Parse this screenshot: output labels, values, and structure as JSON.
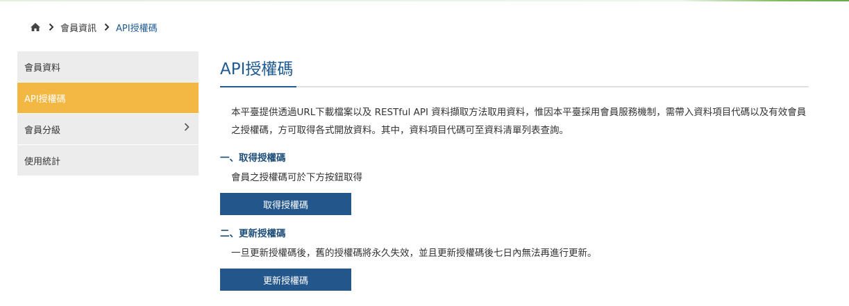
{
  "breadcrumb": {
    "home_icon": "home-icon",
    "separator_icon": "chevron-right-icon",
    "items": [
      "會員資訊",
      "API授權碼"
    ]
  },
  "sidebar": {
    "items": [
      {
        "label": "會員資料",
        "active": false
      },
      {
        "label": "API授權碼",
        "active": true
      },
      {
        "label": "會員分級",
        "active": false,
        "has_submenu": true
      },
      {
        "label": "使用統計",
        "active": false
      }
    ]
  },
  "main": {
    "title": "API授權碼",
    "intro": "本平臺提供透過URL下載檔案以及 RESTful API 資料擷取方法取用資料，惟因本平臺採用會員服務機制，需帶入資料項目代碼以及有效會員之授權碼，方可取得各式開放資料。其中，資料項目代碼可至資料清單列表查詢。",
    "sections": [
      {
        "heading": "一、取得授權碼",
        "description": "會員之授權碼可於下方按鈕取得",
        "button_label": "取得授權碼"
      },
      {
        "heading": "二、更新授權碼",
        "description": "一旦更新授權碼後，舊的授權碼將永久失效，並且更新授權碼後七日內無法再進行更新。",
        "button_label": "更新授權碼"
      }
    ]
  },
  "colors": {
    "accent_blue": "#1f5a91",
    "button_blue": "#23578c",
    "active_menu": "#f2b843",
    "menu_bg": "#ececec"
  }
}
